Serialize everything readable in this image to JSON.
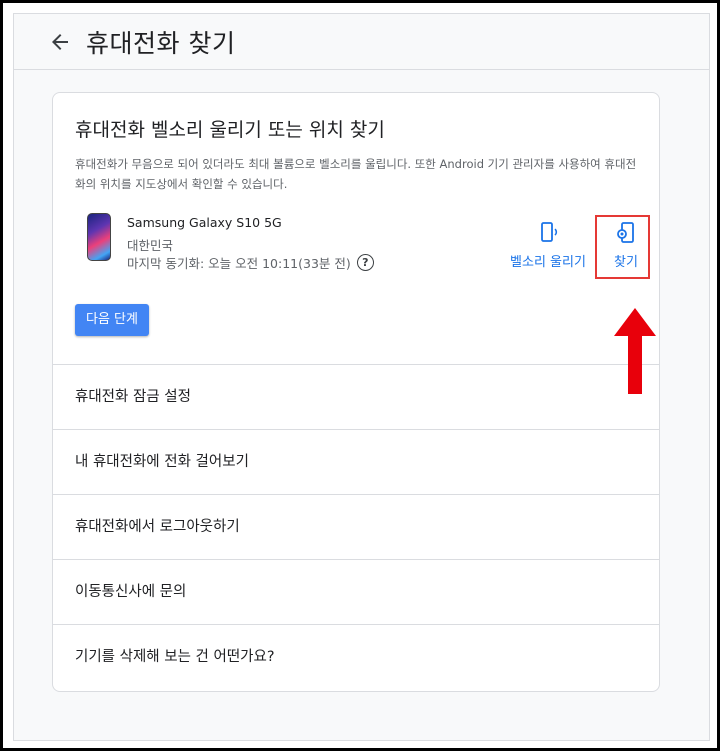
{
  "header": {
    "title": "휴대전화 찾기"
  },
  "card": {
    "title": "휴대전화 벨소리 울리기 또는 위치 찾기",
    "description": "휴대전화가 무음으로 되어 있더라도 최대 볼륨으로 벨소리를 울립니다. 또한 Android 기기 관리자를 사용하여 휴대전화의 위치를 지도상에서 확인할 수 있습니다."
  },
  "device": {
    "name": "Samsung Galaxy S10 5G",
    "country": "대한민국",
    "last_sync": "마지막 동기화: 오늘 오전 10:11(33분 전)",
    "help_glyph": "?"
  },
  "actions": {
    "ring_label": "벨소리 울리기",
    "find_label": "찾기"
  },
  "next_button_label": "다음 단계",
  "menu_items": [
    {
      "label": "휴대전화 잠금 설정"
    },
    {
      "label": "내 휴대전화에 전화 걸어보기"
    },
    {
      "label": "휴대전화에서 로그아웃하기"
    },
    {
      "label": "이동통신사에 문의"
    },
    {
      "label": "기기를 삭제해 보는 건 어떤가요?"
    }
  ],
  "colors": {
    "accent": "#1a73e8",
    "button": "#4285f4",
    "highlight": "#e53935",
    "arrow": "#e8000b"
  },
  "icons": [
    "back-arrow-icon",
    "phone-ring-icon",
    "phone-locate-icon",
    "help-icon",
    "up-arrow-annotation"
  ]
}
